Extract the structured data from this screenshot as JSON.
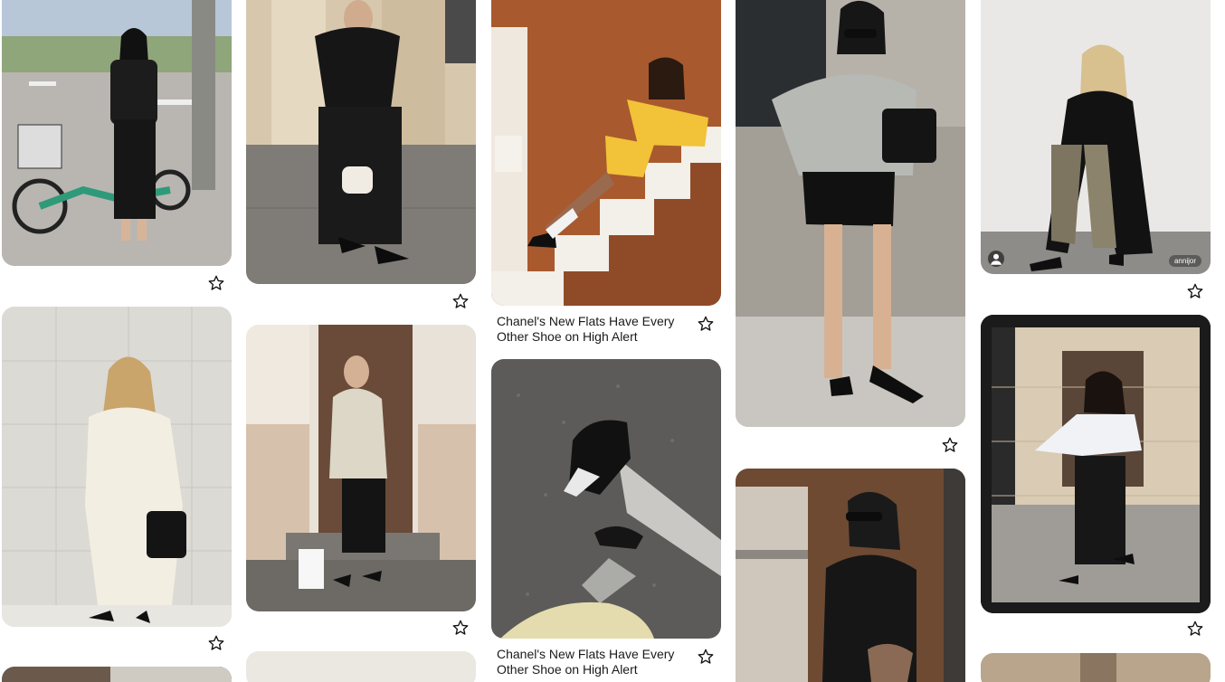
{
  "pins": [
    {
      "id": "p1",
      "caption": "",
      "alt": "Woman in black tee and skirt with green bike"
    },
    {
      "id": "p2",
      "caption": "",
      "alt": "Woman in black suit with white bag"
    },
    {
      "id": "p3",
      "caption": "Chanel's New Flats Have Every Other Shoe on High Alert",
      "alt": "Woman in yellow knit on stairs"
    },
    {
      "id": "p4",
      "caption": "",
      "alt": "Woman in grey sweater and black shorts"
    },
    {
      "id": "p5",
      "caption": "",
      "alt": "Woman in long black coat and snake print pants",
      "watermark": "annijor"
    },
    {
      "id": "p6",
      "caption": "",
      "alt": "Woman in cream trench coat"
    },
    {
      "id": "p7",
      "caption": "",
      "alt": "Woman in beige jacket at doorway"
    },
    {
      "id": "p8",
      "caption": "Chanel's New Flats Have Every Other Shoe on High Alert",
      "alt": "Black patent flats on gravel"
    },
    {
      "id": "p9",
      "caption": "",
      "alt": "Woman with sunglasses in leather jacket"
    },
    {
      "id": "p10",
      "caption": "",
      "alt": "Woman in white tweed crop top and black skirt"
    }
  ],
  "icons": {
    "save": "star-outline-icon"
  }
}
